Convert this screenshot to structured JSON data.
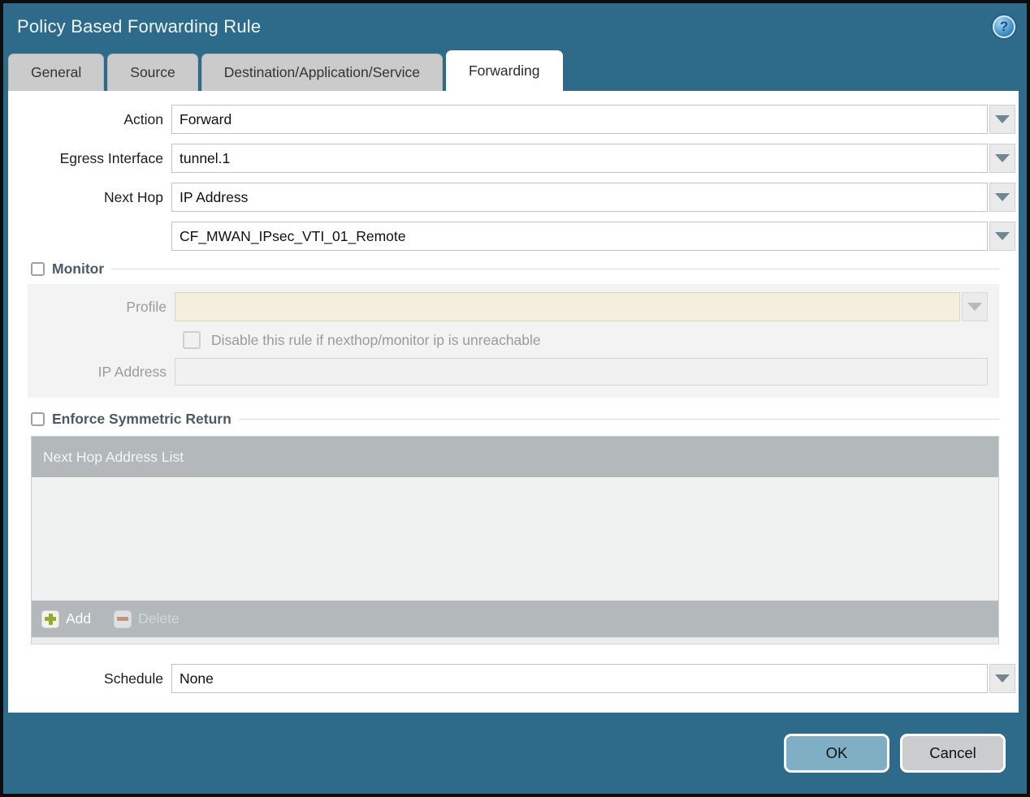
{
  "window": {
    "title": "Policy Based Forwarding Rule",
    "help_icon_glyph": "?"
  },
  "tabs": [
    {
      "label": "General",
      "active": false
    },
    {
      "label": "Source",
      "active": false
    },
    {
      "label": "Destination/Application/Service",
      "active": false
    },
    {
      "label": "Forwarding",
      "active": true
    }
  ],
  "form": {
    "action": {
      "label": "Action",
      "value": "Forward"
    },
    "egress_interface": {
      "label": "Egress Interface",
      "value": "tunnel.1"
    },
    "next_hop": {
      "label": "Next Hop",
      "value": "IP Address"
    },
    "next_hop_address": {
      "label": "",
      "value": "CF_MWAN_IPsec_VTI_01_Remote"
    },
    "schedule": {
      "label": "Schedule",
      "value": "None"
    }
  },
  "monitor": {
    "legend": "Monitor",
    "checked": false,
    "profile": {
      "label": "Profile",
      "value": ""
    },
    "disable_rule": {
      "label": "Disable this rule if nexthop/monitor ip is unreachable",
      "checked": false
    },
    "ip_address": {
      "label": "IP Address",
      "value": ""
    }
  },
  "enforce_symmetric_return": {
    "legend": "Enforce Symmetric Return",
    "checked": false,
    "table": {
      "header": "Next Hop Address List",
      "rows": []
    },
    "add_label": "Add",
    "delete_label": "Delete"
  },
  "footer": {
    "ok_label": "OK",
    "cancel_label": "Cancel"
  },
  "colors": {
    "titlebar_teal": "#2e6b8a",
    "tab_inactive_gray": "#cbcbcb",
    "ok_button_blue": "#7fafc4",
    "cancel_button_gray": "#caccce",
    "table_header_gray": "#b3b8bb",
    "disabled_field_beige": "#f4eedd",
    "add_icon_green": "#94a83e",
    "delete_icon_red": "#bb9486"
  }
}
